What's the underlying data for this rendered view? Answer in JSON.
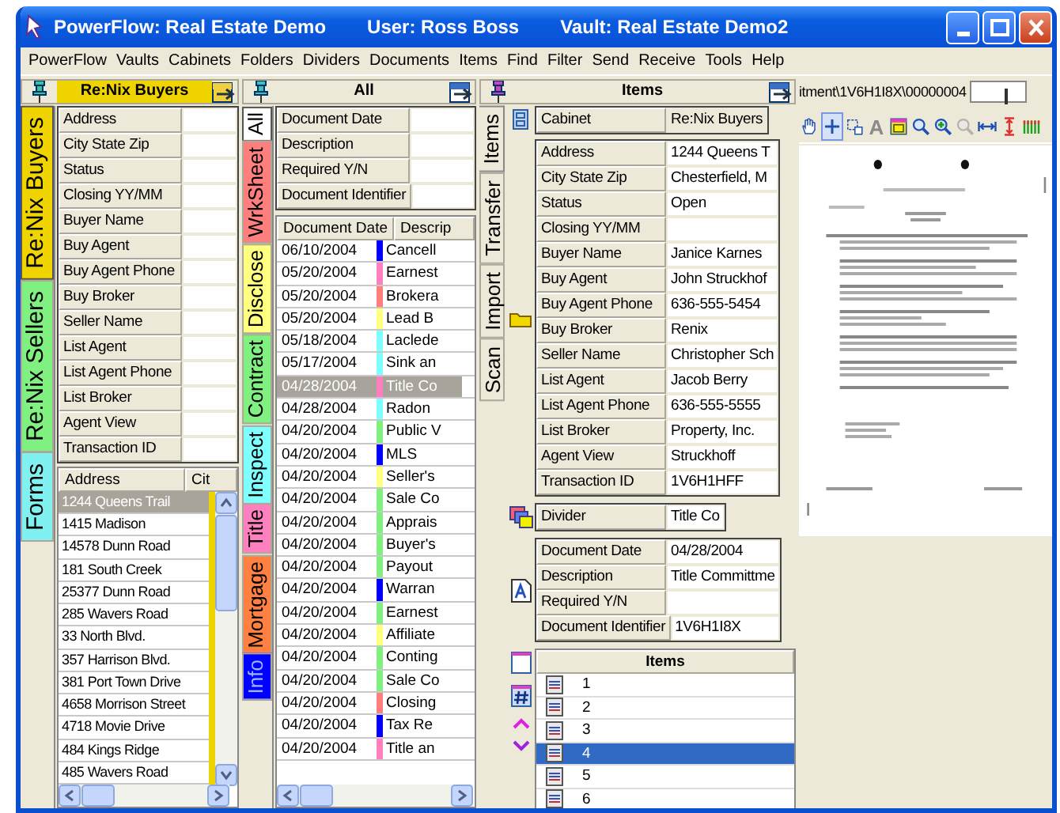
{
  "window": {
    "title": "PowerFlow: Real Estate Demo",
    "user": "User: Ross Boss",
    "vault": "Vault: Real Estate Demo2"
  },
  "menu": [
    "PowerFlow",
    "Vaults",
    "Cabinets",
    "Folders",
    "Dividers",
    "Documents",
    "Items",
    "Find",
    "Filter",
    "Send",
    "Receive",
    "Tools",
    "Help"
  ],
  "cabinet_panel": {
    "header": "Re:Nix Buyers",
    "tabs": [
      {
        "label": "Re:Nix Buyers",
        "color": "#f0d400",
        "selected": true
      },
      {
        "label": "Re:Nix Sellers",
        "color": "#80f080",
        "selected": false
      },
      {
        "label": "Forms",
        "color": "#80f0f0",
        "selected": false
      }
    ],
    "fields": [
      "Address",
      "City State Zip",
      "Status",
      "Closing YY/MM",
      "Buyer Name",
      "Buy Agent",
      "Buy Agent Phone",
      "Buy Broker",
      "Seller Name",
      "List Agent",
      "List Agent Phone",
      "List Broker",
      "Agent View",
      "Transaction ID"
    ],
    "folder_list": {
      "columns": [
        "Address",
        "Cit"
      ],
      "rows": [
        {
          "address": "1244 Queens Trail",
          "selected": true
        },
        {
          "address": "1415 Madison",
          "selected": false
        },
        {
          "address": "14578 Dunn Road",
          "selected": false
        },
        {
          "address": "181 South Creek",
          "selected": false
        },
        {
          "address": "25377 Dunn Road",
          "selected": false
        },
        {
          "address": "285 Wavers Road",
          "selected": false
        },
        {
          "address": "33 North Blvd.",
          "selected": false
        },
        {
          "address": "357 Harrison Blvd.",
          "selected": false
        },
        {
          "address": "381 Port Town Drive",
          "selected": false
        },
        {
          "address": "4658 Morrison Street",
          "selected": false
        },
        {
          "address": "4718 Movie Drive",
          "selected": false
        },
        {
          "address": "484 Kings Ridge",
          "selected": false
        },
        {
          "address": "485 Wavers Road",
          "selected": false
        }
      ]
    }
  },
  "divider_panel": {
    "header": "All",
    "tabs": [
      {
        "label": "All",
        "selected": true
      },
      {
        "label": "WrkSheet",
        "color": "#ff7f7f",
        "selected": false
      },
      {
        "label": "Disclose",
        "color": "#ffff80",
        "selected": false
      },
      {
        "label": "Contract",
        "color": "#80f080",
        "selected": false
      },
      {
        "label": "Inspect",
        "color": "#80ffff",
        "selected": false
      },
      {
        "label": "Title",
        "color": "#ff80c0",
        "selected": false
      },
      {
        "label": "Mortgage",
        "color": "#ff8040",
        "selected": false
      },
      {
        "label": "Info",
        "color": "#0000ff",
        "selected": false
      }
    ],
    "fields": [
      "Document Date",
      "Description",
      "Required Y/N",
      "Document Identifier"
    ],
    "document_table": {
      "columns": [
        "Document Date",
        "Descrip"
      ],
      "rows": [
        {
          "date": "06/10/2004",
          "description": "Cancell",
          "color": "#0000ff",
          "selected": false
        },
        {
          "date": "05/20/2004",
          "description": "Earnest",
          "color": "#ff80c0",
          "selected": false
        },
        {
          "date": "05/20/2004",
          "description": "Brokera",
          "color": "#ff7f7f",
          "selected": false
        },
        {
          "date": "05/20/2004",
          "description": "Lead B",
          "color": "#ffff80",
          "selected": false
        },
        {
          "date": "05/18/2004",
          "description": "Laclede",
          "color": "#80ffff",
          "selected": false
        },
        {
          "date": "05/17/2004",
          "description": "Sink an",
          "color": "#80ffff",
          "selected": false
        },
        {
          "date": "04/28/2004",
          "description": "Title Co",
          "color": "#ff80c0",
          "selected": true
        },
        {
          "date": "04/28/2004",
          "description": "Radon",
          "color": "#80ffff",
          "selected": false
        },
        {
          "date": "04/20/2004",
          "description": "Public V",
          "color": "#80f080",
          "selected": false
        },
        {
          "date": "04/20/2004",
          "description": "MLS",
          "color": "#0000ff",
          "selected": false
        },
        {
          "date": "04/20/2004",
          "description": "Seller's",
          "color": "#ffff80",
          "selected": false
        },
        {
          "date": "04/20/2004",
          "description": "Sale Co",
          "color": "#80f080",
          "selected": false
        },
        {
          "date": "04/20/2004",
          "description": "Apprais",
          "color": "#80f080",
          "selected": false
        },
        {
          "date": "04/20/2004",
          "description": "Buyer's",
          "color": "#80f080",
          "selected": false
        },
        {
          "date": "04/20/2004",
          "description": "Payout",
          "color": "#80f080",
          "selected": false
        },
        {
          "date": "04/20/2004",
          "description": "Warran",
          "color": "#0000ff",
          "selected": false
        },
        {
          "date": "04/20/2004",
          "description": "Earnest",
          "color": "#80f080",
          "selected": false
        },
        {
          "date": "04/20/2004",
          "description": "Affiliate",
          "color": "#ffff80",
          "selected": false
        },
        {
          "date": "04/20/2004",
          "description": "Conting",
          "color": "#80f080",
          "selected": false
        },
        {
          "date": "04/20/2004",
          "description": "Sale Co",
          "color": "#80f080",
          "selected": false
        },
        {
          "date": "04/20/2004",
          "description": "Closing",
          "color": "#ff7f7f",
          "selected": false
        },
        {
          "date": "04/20/2004",
          "description": "Tax Re",
          "color": "#0000ff",
          "selected": false
        },
        {
          "date": "04/20/2004",
          "description": "Title an",
          "color": "#ff80c0",
          "selected": false
        }
      ]
    }
  },
  "item_panel": {
    "header": "Items",
    "tabs": [
      {
        "label": "Items",
        "selected": true
      },
      {
        "label": "Transfer",
        "selected": false
      },
      {
        "label": "Import",
        "selected": false
      },
      {
        "label": "Scan",
        "selected": false
      }
    ],
    "cabinet": {
      "label": "Cabinet",
      "value": "Re:Nix Buyers"
    },
    "folder_fields": [
      {
        "label": "Address",
        "value": "1244 Queens T"
      },
      {
        "label": "City State Zip",
        "value": "Chesterfield, M"
      },
      {
        "label": "Status",
        "value": "Open"
      },
      {
        "label": "Closing YY/MM"
      },
      {
        "label": "Buyer Name",
        "value": "Janice Karnes"
      },
      {
        "label": "Buy Agent",
        "value": "John Struckhof"
      },
      {
        "label": "Buy Agent Phone",
        "value": "636-555-5454"
      },
      {
        "label": "Buy Broker",
        "value": "Renix"
      },
      {
        "label": "Seller Name",
        "value": "Christopher Sch"
      },
      {
        "label": "List Agent",
        "value": "Jacob Berry"
      },
      {
        "label": "List Agent Phone",
        "value": "636-555-5555"
      },
      {
        "label": "List Broker",
        "value": "Property, Inc."
      },
      {
        "label": "Agent View",
        "value": "Struckhoff"
      },
      {
        "label": "Transaction ID",
        "value": "1V6H1HFF"
      }
    ],
    "divider": {
      "label": "Divider",
      "value": "Title Co"
    },
    "document_fields": [
      {
        "label": "Document Date",
        "value": "04/28/2004"
      },
      {
        "label": "Description",
        "value": "Title Committme"
      },
      {
        "label": "Required Y/N"
      },
      {
        "label": "Document Identifier",
        "value": "1V6H1I8X"
      }
    ],
    "items_list": {
      "header": "Items",
      "rows": [
        {
          "label": "1",
          "selected": false
        },
        {
          "label": "2",
          "selected": false
        },
        {
          "label": "3",
          "selected": false
        },
        {
          "label": "4",
          "selected": true
        },
        {
          "label": "5",
          "selected": false
        },
        {
          "label": "6",
          "selected": false
        }
      ]
    }
  },
  "viewer": {
    "path": "itment\\1V6H1I8X\\00000004",
    "zoom": {
      "level": 0.62
    },
    "tools": [
      {
        "kind": "hand",
        "selected": false,
        "disabled": false
      },
      {
        "kind": "crosshair",
        "selected": true,
        "disabled": false
      },
      {
        "kind": "select",
        "selected": false,
        "disabled": false
      },
      {
        "kind": "text",
        "label": "A",
        "selected": false,
        "disabled": true
      },
      {
        "kind": "window",
        "selected": false,
        "disabled": false
      },
      {
        "kind": "zoom",
        "selected": false,
        "disabled": false
      },
      {
        "kind": "zoom-in",
        "selected": false,
        "disabled": false
      },
      {
        "kind": "zoom-out",
        "selected": false,
        "disabled": true
      },
      {
        "kind": "fit-width",
        "selected": false,
        "disabled": false
      },
      {
        "kind": "fit-height",
        "selected": false,
        "disabled": false
      },
      {
        "kind": "columns",
        "selected": false,
        "disabled": false
      }
    ]
  }
}
